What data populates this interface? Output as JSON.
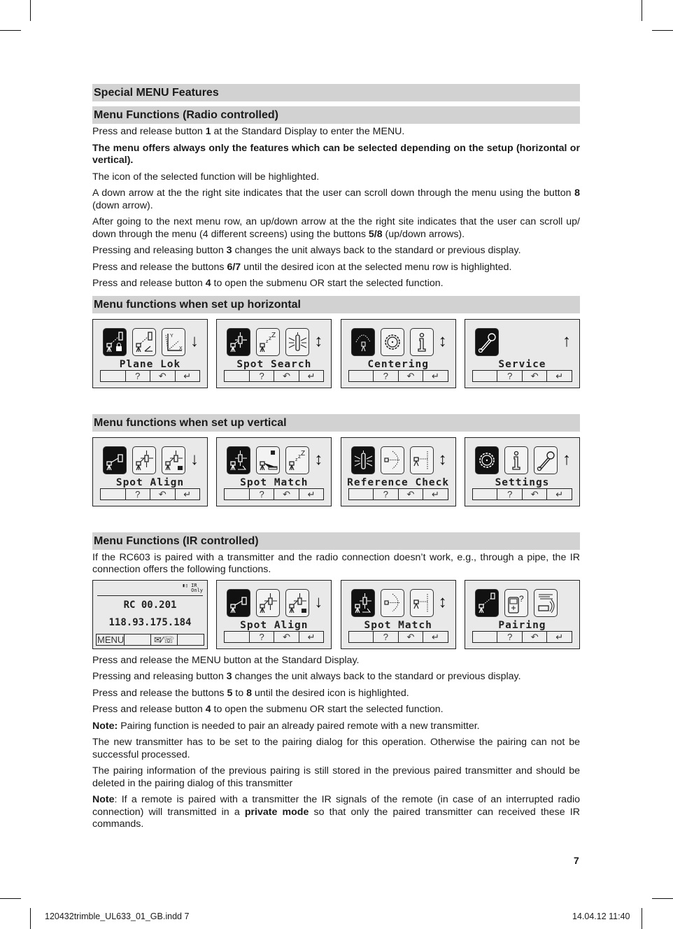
{
  "sections": {
    "special_menu": "Special MENU Features",
    "radio": {
      "heading": "Menu Functions (Radio controlled)",
      "p1": {
        "pre": "Press and release button ",
        "b": "1",
        "post": " at the Standard Display to enter the MENU."
      },
      "p2_bold": "The menu offers always only the features which can be selected depending on the setup (horizontal or vertical).",
      "p3": "The icon of the selected function will be highlighted.",
      "p4": {
        "pre": "A down arrow at the the right site indicates that the user can scroll  down through the menu using the button ",
        "b": "8",
        "post": " (down arrow)."
      },
      "p5": {
        "pre": "After going to the next menu row, an up/down arrow at the the right site indicates that the user can scroll up/ down through the menu (4 different screens) using the buttons ",
        "b": "5/8",
        "post": " (up/down arrows)."
      },
      "p6": {
        "pre": "Pressing and releasing button ",
        "b": "3",
        "post": " changes the unit always back to the standard or previous display."
      },
      "p7": {
        "pre": "Press and release the buttons ",
        "b": "6/7",
        "post": " until the desired icon at the selected menu row is highlighted."
      },
      "p8": {
        "pre": "Press and release button ",
        "b": "4",
        "post": " to open the submenu OR start the selected function."
      }
    },
    "horizontal": {
      "heading": "Menu functions when set up horizontal",
      "screens": [
        {
          "label": "Plane Lok",
          "arrow": "↓",
          "icons": [
            "plane-lok-icon",
            "slope-icon",
            "axis-icon"
          ]
        },
        {
          "label": "Spot Search",
          "arrow": "↕",
          "icons": [
            "spot-search-icon",
            "sleep-icon",
            "beacon-icon"
          ]
        },
        {
          "label": "Centering",
          "arrow": "↕",
          "icons": [
            "centering-icon",
            "settings-gear-icon",
            "info-icon"
          ]
        },
        {
          "label": "Service",
          "arrow": "↑",
          "icons": [
            "wrench-icon"
          ]
        }
      ]
    },
    "vertical": {
      "heading": "Menu functions when set up vertical",
      "screens": [
        {
          "label": "Spot Align",
          "arrow": "↓",
          "icons": [
            "spot-align-icon",
            "cross-arrows-icon",
            "cross-arrows-lock-icon"
          ]
        },
        {
          "label": "Spot Match",
          "arrow": "↕",
          "icons": [
            "spot-match-icon",
            "lock-target-icon",
            "sleep-icon"
          ]
        },
        {
          "label": "Reference Check",
          "arrow": "↕",
          "icons": [
            "beacon-icon",
            "arc-icon",
            "vertical-scan-icon"
          ]
        },
        {
          "label": "Settings",
          "arrow": "↑",
          "icons": [
            "settings-gear-icon",
            "info-icon",
            "wrench-icon"
          ]
        }
      ]
    },
    "ir": {
      "heading": "Menu Functions (IR controlled)",
      "intro": "If the RC603 is paired with a transmitter and the radio connection doesn’t work, e.g., through a pipe, the IR connection offers the following functions.",
      "standard_display": {
        "ir_label_1": "IR",
        "ir_label_2": "Only",
        "line1": "RC 00.201",
        "line2": "118.93.175.184",
        "menu_key": "MENU",
        "key3": "✉⁄☏"
      },
      "screens": [
        {
          "label": "Spot Align",
          "arrow": "↓",
          "icons": [
            "spot-align-icon",
            "cross-arrows-icon",
            "cross-arrows-lock-icon"
          ]
        },
        {
          "label": "Spot Match",
          "arrow": "↕",
          "icons": [
            "spot-match-icon",
            "arc-icon",
            "vertical-scan-icon"
          ]
        },
        {
          "label": "Pairing",
          "arrow": "",
          "icons": [
            "pairing-icon",
            "remote-question-icon",
            "ir-signal-icon"
          ]
        }
      ],
      "p1": "Press and release the MENU button at the Standard Display.",
      "p2": {
        "pre": "Pressing and releasing button ",
        "b": "3",
        "post": " changes the unit always back to the standard or previous display."
      },
      "p3": {
        "pre": "Press and release the buttons ",
        "b1": "5",
        "mid": " to ",
        "b2": "8",
        "post": " until the desired icon is highlighted."
      },
      "p4": {
        "pre": "Press and release button ",
        "b": "4",
        "post": " to open the submenu OR start the selected function."
      },
      "p5": {
        "b": "Note:",
        "post": " Pairing function is needed to pair an already paired remote with a new transmitter."
      },
      "p6": "The new transmitter has to be set to the pairing dialog for this operation. Otherwise the pairing can not be successful processed.",
      "p7": "The pairing information of the previous pairing is still stored in the previous paired transmitter and should be deleted in the pairing dialog of this transmitter",
      "p8": {
        "b": "Note",
        "pre": ": If a remote is paired with a transmitter the IR signals of the remote (in case of an interrupted radio connection) will transmitted in a ",
        "b2": "private mode",
        "post": " so that only the paired transmitter can received these IR commands."
      }
    }
  },
  "softkeys": [
    "",
    "?",
    "↶",
    "↵"
  ],
  "page_number": "7",
  "slug": {
    "file": "120432trimble_UL633_01_GB.indd   7",
    "date": "14.04.12   11:40"
  }
}
